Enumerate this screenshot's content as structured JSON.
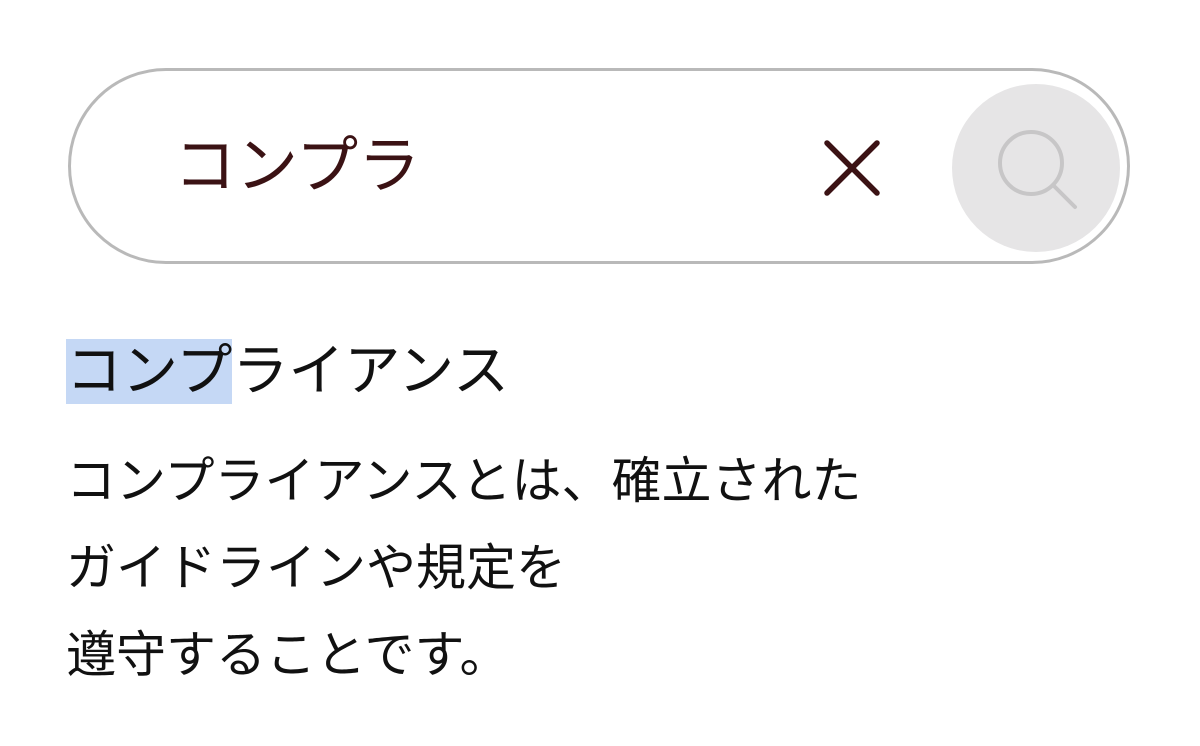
{
  "search": {
    "query": "コンプラ",
    "clear_icon": "close-icon",
    "search_icon": "search-icon"
  },
  "result": {
    "title_match": "コンプ",
    "title_rest": "ライアンス",
    "description_lines": [
      "コンプライアンスとは、確立された",
      "ガイドラインや規定を",
      "遵守することです。"
    ]
  },
  "colors": {
    "query_text": "#3b1214",
    "highlight": "#c5d8f5",
    "search_button_bg": "#e6e5e6",
    "border": "#b9b9b9"
  }
}
